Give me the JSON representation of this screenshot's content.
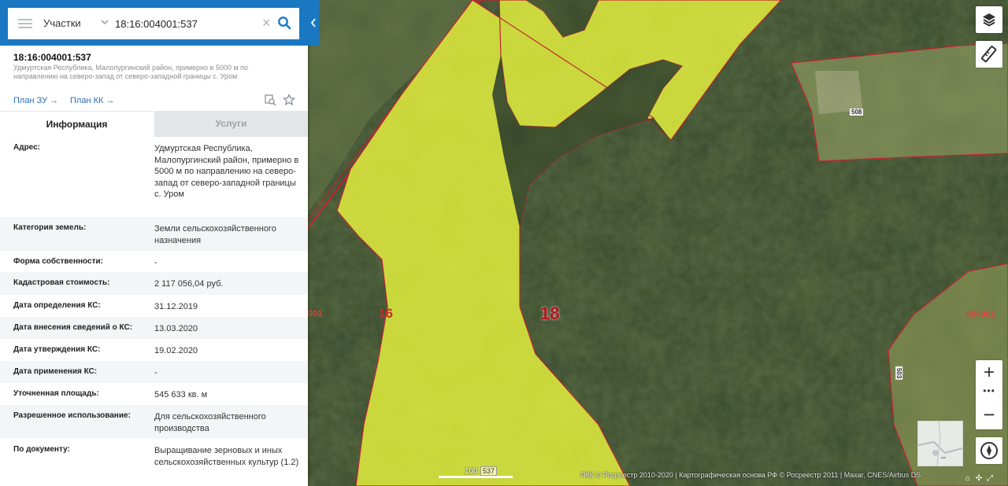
{
  "search": {
    "type_label": "Участки",
    "query": "18:16:004001:537"
  },
  "parcel": {
    "number": "18:16:004001:537",
    "short_address": "Удмуртская Республика, Малопургинский район, примерно в 5000 м по направлению на северо-запад от северо-западной границы с. Уром",
    "plan_zu": "План ЗУ",
    "plan_kk": "План КК"
  },
  "tabs": {
    "info": "Информация",
    "services": "Услуги"
  },
  "rows": [
    {
      "label": "Адрес:",
      "value": "Удмуртская Республика, Малопургинский район, примерно в 5000 м по направлению на северо-запад от северо-западной границы с. Уром"
    },
    {
      "label": "Категория земель:",
      "value": "Земли сельскохозяйственного назначения"
    },
    {
      "label": "Форма собственности:",
      "value": "-"
    },
    {
      "label": "Кадастровая стоимость:",
      "value": "2 117 056,04 руб."
    },
    {
      "label": "Дата определения КС:",
      "value": "31.12.2019"
    },
    {
      "label": "Дата внесения сведений о КС:",
      "value": "13.03.2020"
    },
    {
      "label": "Дата утверждения КС:",
      "value": "19.02.2020"
    },
    {
      "label": "Дата применения КС:",
      "value": "-"
    },
    {
      "label": "Уточненная площадь:",
      "value": "545 633 кв. м"
    },
    {
      "label": "Разрешенное использование:",
      "value": "Для сельскохозяйственного производства"
    },
    {
      "label": "По документу:",
      "value": "Выращивание зерновых и иных сельскохозяйственных культур (1.2)"
    }
  ],
  "map": {
    "labels": {
      "parcel": "18",
      "left_parcel": "16",
      "left_edge": "001",
      "right_quarter": "004001",
      "top_right": "508",
      "bottom_right": "503"
    },
    "scale_text": "100",
    "scale_chip": "537",
    "attribution": "ПКК © Росреестр 2010-2020 | Картографическая основа РФ © Росреестр 2011 | Maxar, CNES/Airbus DS",
    "zoom_in": "+",
    "zoom_more": "•••",
    "zoom_out": "−"
  },
  "colors": {
    "header_blue": "#1a78c2",
    "parcel_fill": "#d4e23a",
    "boundary_red": "#c8102e",
    "link_blue": "#2a6fb3"
  },
  "icons": [
    "menu-icon",
    "chevron-down-icon",
    "clear-icon",
    "search-icon",
    "collapse-icon",
    "copy-icon",
    "star-icon",
    "layers-icon",
    "ruler-icon",
    "compass-icon",
    "home-icon",
    "locate-icon",
    "fullscreen-icon"
  ]
}
